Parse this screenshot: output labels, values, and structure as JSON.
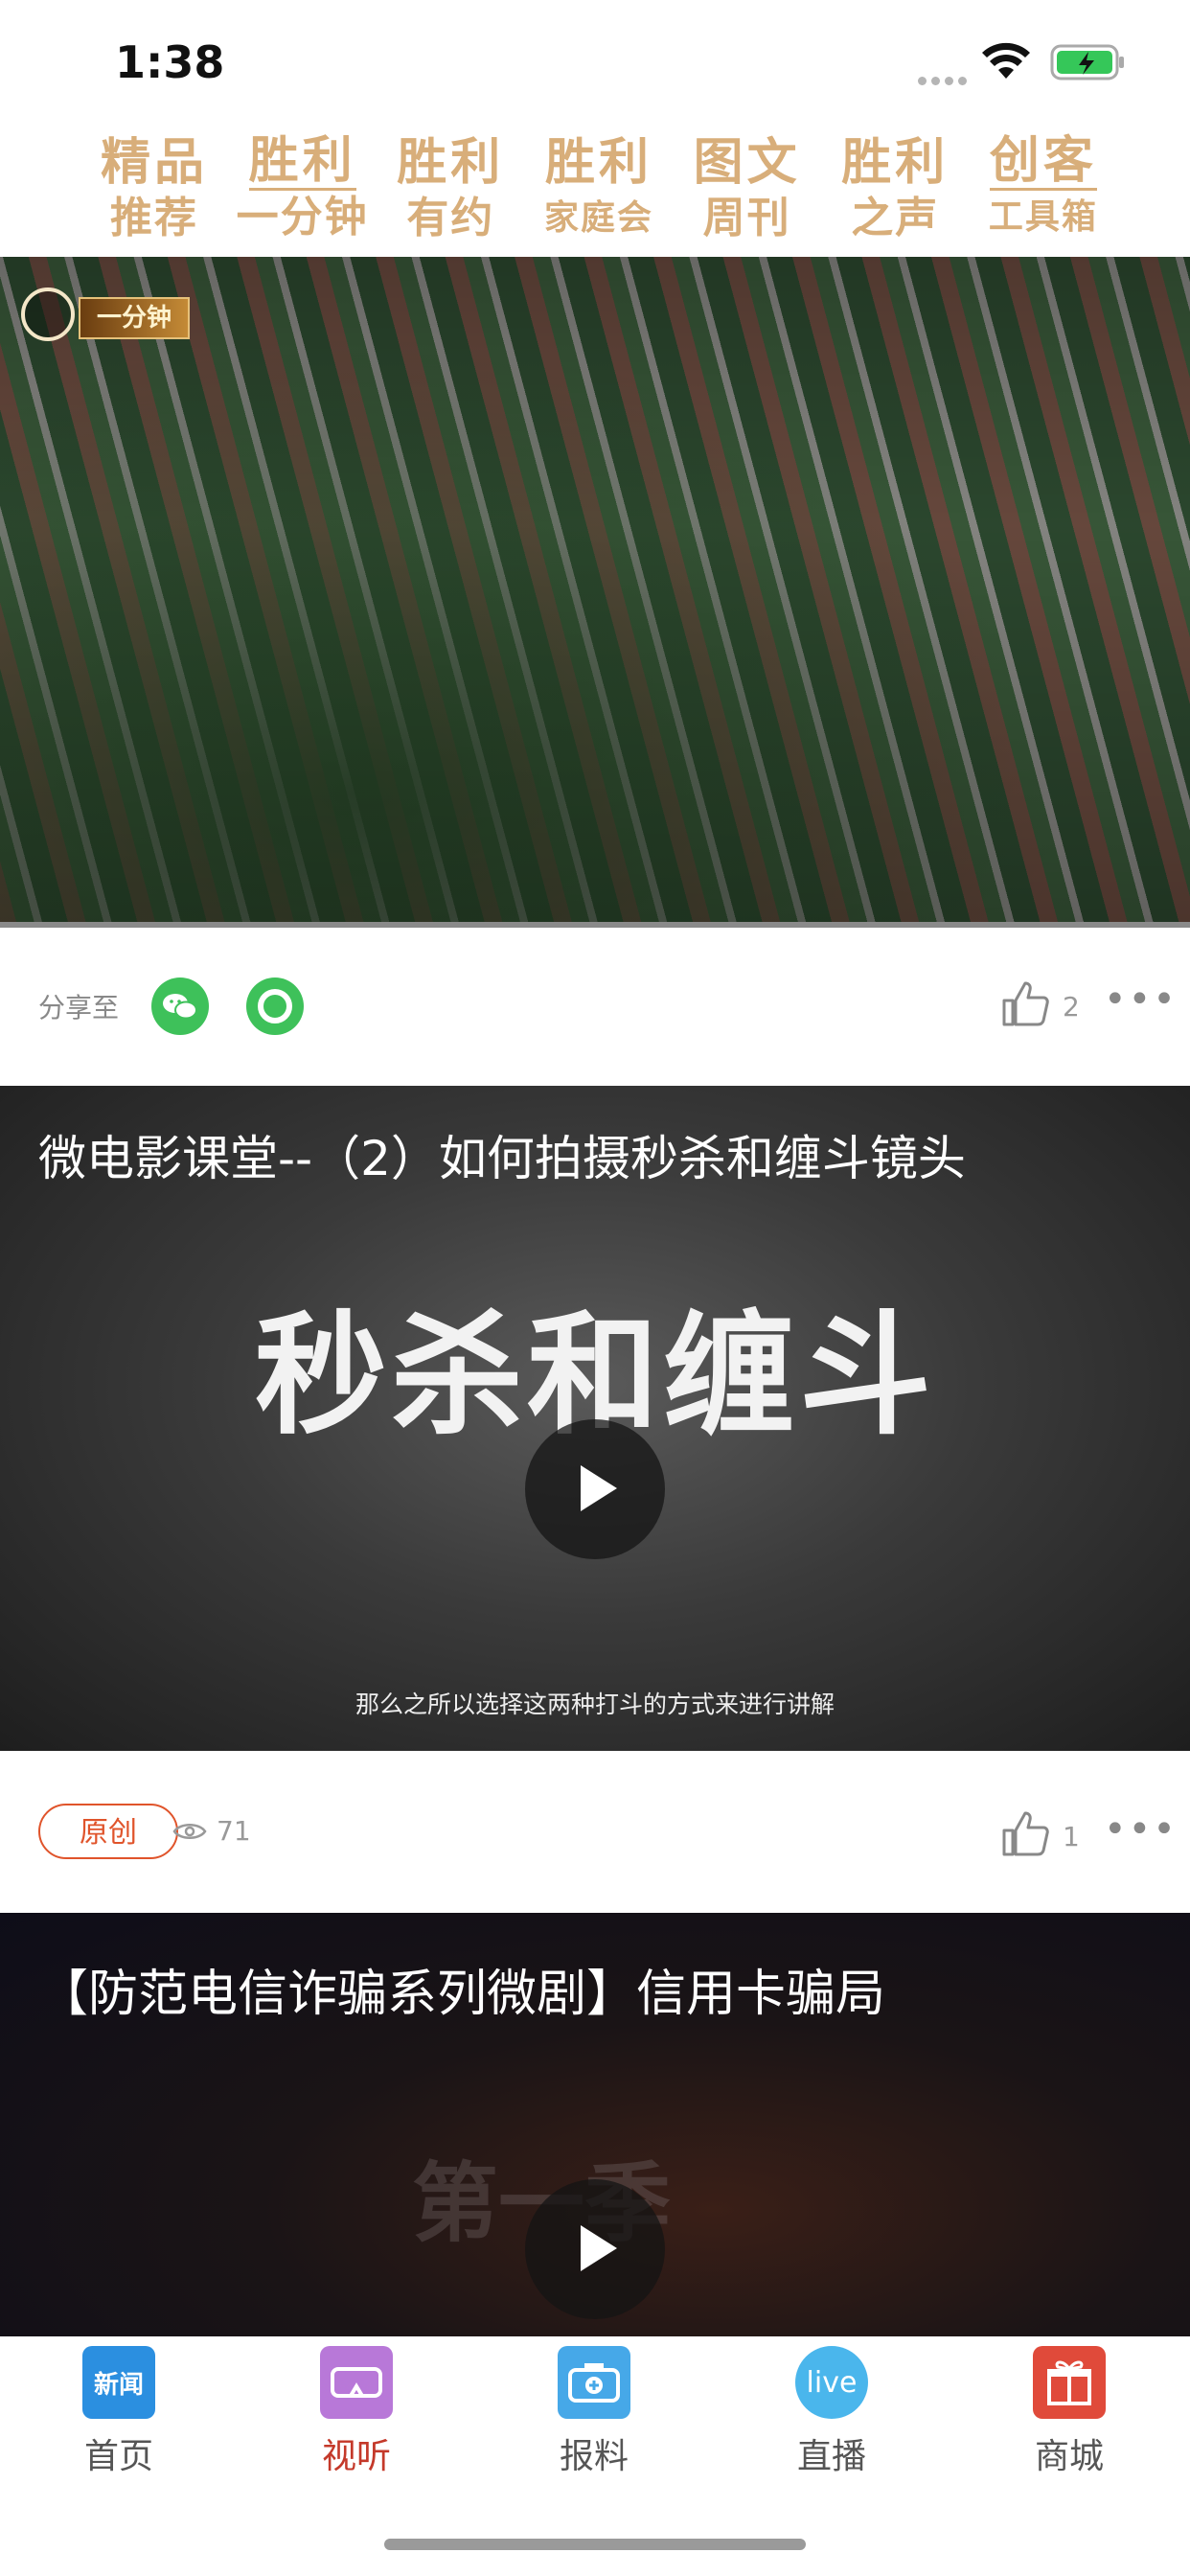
{
  "status_bar": {
    "time": "1:38"
  },
  "categories": [
    {
      "line1": "精品",
      "line2": "推荐"
    },
    {
      "line1": "胜利",
      "line2": "一分钟"
    },
    {
      "line1": "胜利",
      "line2": "有约"
    },
    {
      "line1": "胜利",
      "line2": "家庭会"
    },
    {
      "line1": "图文",
      "line2": "周刊"
    },
    {
      "line1": "胜利",
      "line2": "之声"
    },
    {
      "line1": "创客",
      "line2": "工具箱"
    }
  ],
  "video1": {
    "logo_text": "一分钟",
    "share_label": "分享至",
    "likes": "2"
  },
  "video2": {
    "title": "微电影课堂--（2）如何拍摄秒杀和缠斗镜头",
    "overlay_title": "秒杀和缠斗",
    "subtitle": "那么之所以选择这两种打斗的方式来进行讲解",
    "badge": "原创",
    "views": "71",
    "likes": "1"
  },
  "video3": {
    "title": "【防范电信诈骗系列微剧】信用卡骗局",
    "overlay_title": "第一季"
  },
  "tabbar": {
    "tabs": [
      {
        "label": "首页",
        "icon": "news-icon",
        "icon_text": "新闻",
        "color": "#2b8fe0"
      },
      {
        "label": "视听",
        "icon": "vr-goggles-icon",
        "icon_text": "",
        "color": "#b878d8"
      },
      {
        "label": "报料",
        "icon": "camera-icon",
        "icon_text": "",
        "color": "#46a8e8"
      },
      {
        "label": "直播",
        "icon": "live-icon",
        "icon_text": "live",
        "color": "#4ab6ec"
      },
      {
        "label": "商城",
        "icon": "gift-icon",
        "icon_text": "",
        "color": "#e04a3a"
      }
    ],
    "active_index": 1
  }
}
